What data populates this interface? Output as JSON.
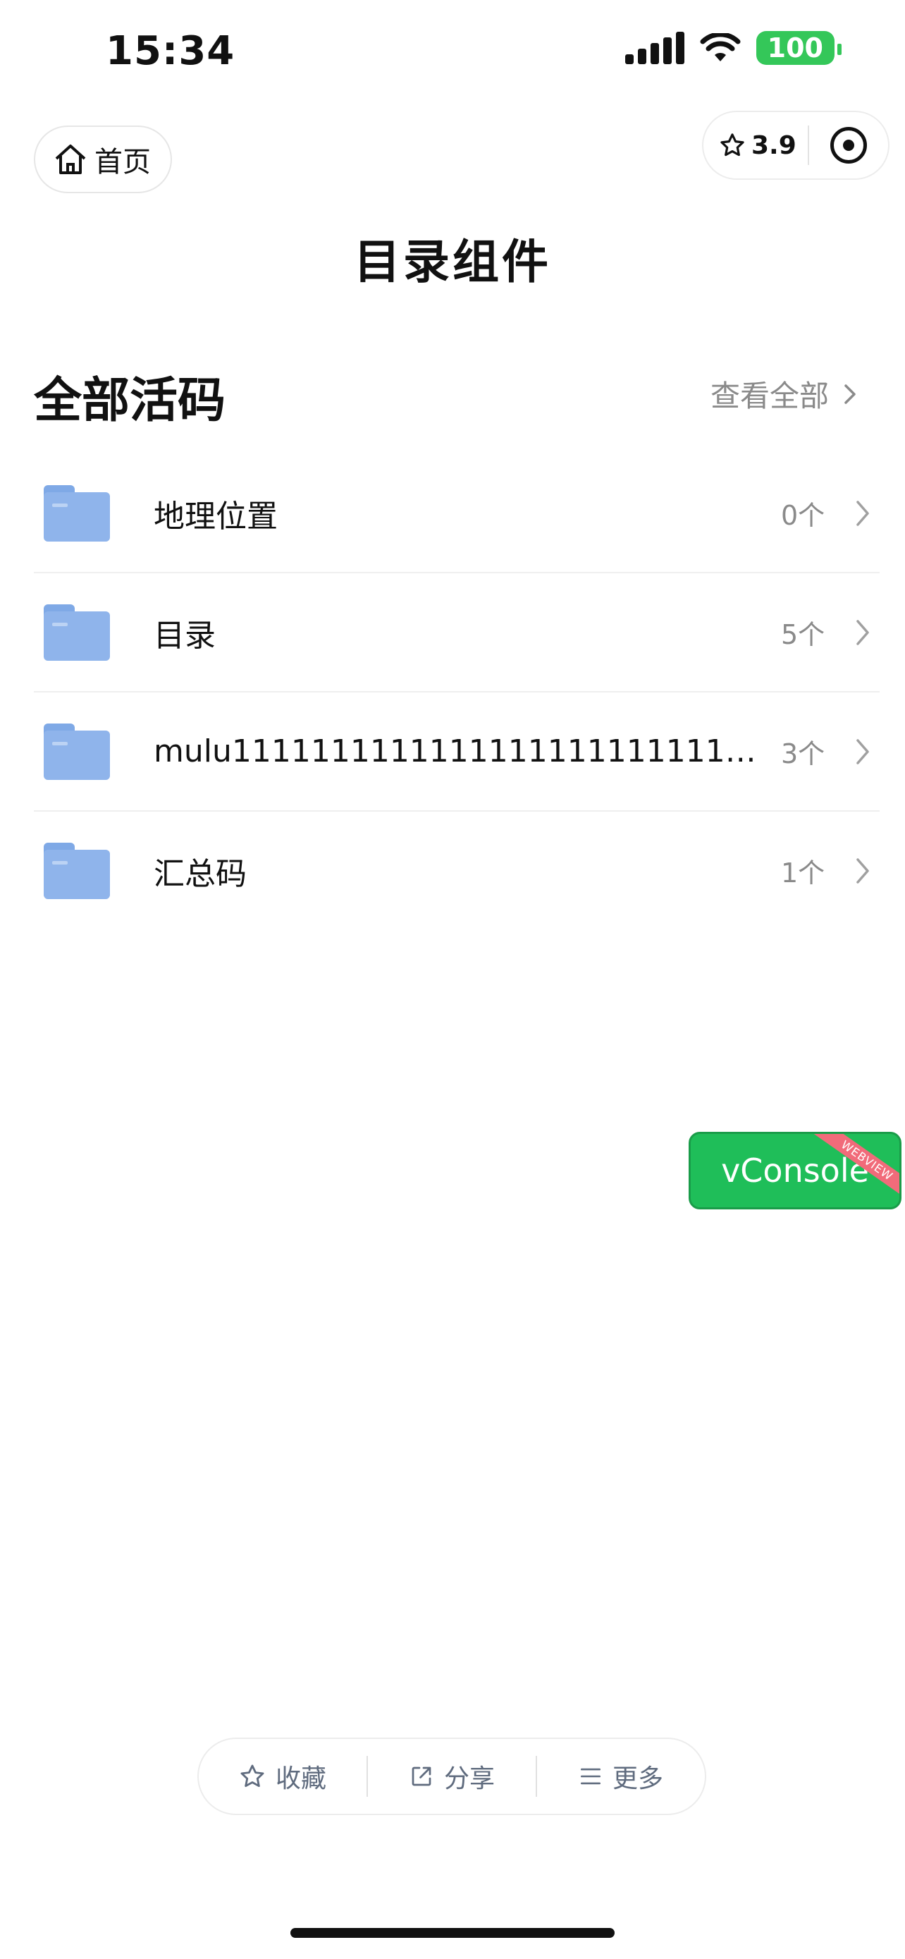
{
  "status_bar": {
    "time": "15:34",
    "battery": "100",
    "icons": [
      "cellular-signal-icon",
      "wifi-icon",
      "battery-icon"
    ]
  },
  "nav": {
    "home_label": "首页",
    "rating": "3.9",
    "capsule_icons": [
      "star-icon",
      "target-icon"
    ]
  },
  "page": {
    "title": "目录组件"
  },
  "section": {
    "title": "全部活码",
    "view_all_label": "查看全部"
  },
  "list": [
    {
      "name": "地理位置",
      "count": "0个"
    },
    {
      "name": "目录",
      "count": "5个"
    },
    {
      "name": "mulu11111111111111111111111111111111111...",
      "count": "3个"
    },
    {
      "name": "汇总码",
      "count": "1个"
    }
  ],
  "vconsole": {
    "label": "vConsole",
    "ribbon": "WEBVIEW"
  },
  "bottom_bar": {
    "favorite_label": "收藏",
    "share_label": "分享",
    "more_label": "更多"
  },
  "colors": {
    "accent_green": "#1fbe59",
    "folder_blue": "#8fb4eb",
    "battery_green": "#34c759",
    "muted_text": "#8a8a8a"
  }
}
